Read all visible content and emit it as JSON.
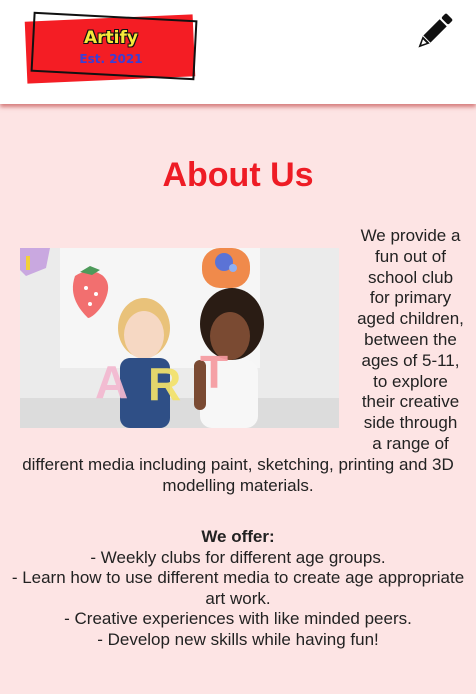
{
  "header": {
    "logo_name": "Artify",
    "logo_est": "Est. 2021",
    "edit_icon": "pencil-icon"
  },
  "about": {
    "title": "About Us",
    "image_letters": [
      "A",
      "R",
      "T"
    ],
    "paragraph": "We provide a fun out of school club for primary aged children, between the ages of 5-11, to explore their creative side through a range of different media including paint, sketching, printing and 3D modelling materials."
  },
  "offer": {
    "heading": "We offer:",
    "items": [
      "- Weekly clubs for different age groups.",
      "- Learn how to use different media to create age appropriate art work.",
      "- Creative experiences with like minded peers.",
      "- Develop new skills while having fun!"
    ]
  },
  "colors": {
    "brand_red": "#ee1c25",
    "page_bg": "#fde4e4",
    "logo_yellow": "#f7e93a",
    "logo_blue": "#3a3fd6"
  }
}
